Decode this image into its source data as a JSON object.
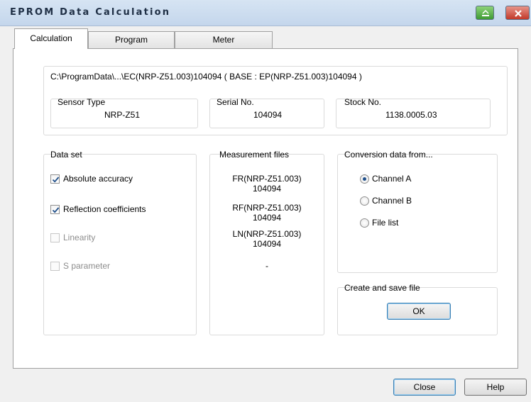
{
  "window": {
    "title": "EPROM Data Calculation"
  },
  "tabs": [
    {
      "label": "Calculation"
    },
    {
      "label": "Program"
    },
    {
      "label": "Meter"
    }
  ],
  "path_text": "C:\\ProgramData\\...\\EC(NRP-Z51.003)104094 ( BASE : EP(NRP-Z51.003)104094 )",
  "sensor": {
    "type_label": "Sensor Type",
    "type_value": "NRP-Z51",
    "serial_label": "Serial No.",
    "serial_value": "104094",
    "stock_label": "Stock No.",
    "stock_value": "1138.0005.03"
  },
  "data_set": {
    "title": "Data set",
    "items": [
      {
        "label": "Absolute accuracy",
        "checked": true,
        "enabled": true
      },
      {
        "label": "Reflection coefficients",
        "checked": true,
        "enabled": true
      },
      {
        "label": "Linearity",
        "checked": false,
        "enabled": false
      },
      {
        "label": "S parameter",
        "checked": false,
        "enabled": false
      }
    ]
  },
  "measurement_files": {
    "title": "Measurement files",
    "entries": [
      {
        "line1": "FR(NRP-Z51.003)",
        "line2": "104094"
      },
      {
        "line1": "RF(NRP-Z51.003)",
        "line2": "104094"
      },
      {
        "line1": "LN(NRP-Z51.003)",
        "line2": "104094"
      }
    ],
    "s_param": "-"
  },
  "conversion": {
    "title": "Conversion data from...",
    "options": [
      {
        "label": "Channel A",
        "selected": true
      },
      {
        "label": "Channel B",
        "selected": false
      },
      {
        "label": "File list",
        "selected": false
      }
    ]
  },
  "create_save": {
    "title": "Create and save file",
    "ok_label": "OK"
  },
  "buttons": {
    "close_label": "Close",
    "help_label": "Help"
  },
  "colors": {
    "accent": "#1f4f8a",
    "titlebar": "#c4d6ec",
    "close_button": "#c2392a",
    "min_button": "#3f9a33"
  }
}
